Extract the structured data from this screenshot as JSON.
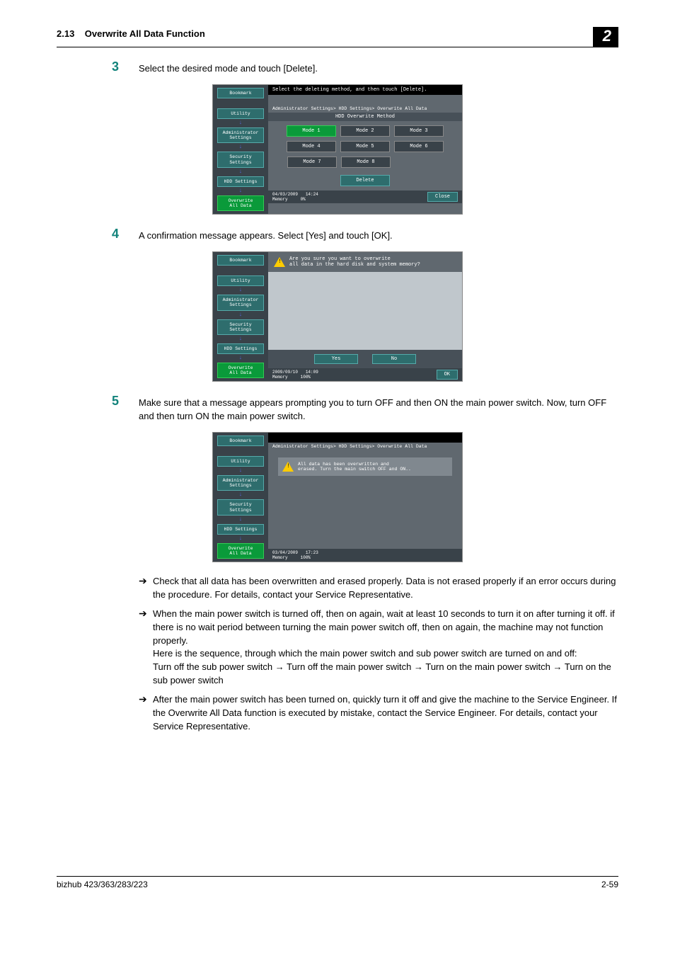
{
  "header": {
    "section": "2.13",
    "title": "Overwrite All Data Function",
    "chapter": "2"
  },
  "steps": {
    "s3": {
      "num": "3",
      "text": "Select the desired mode and touch [Delete]."
    },
    "s4": {
      "num": "4",
      "text": "A confirmation message appears. Select [Yes] and touch [OK]."
    },
    "s5": {
      "num": "5",
      "text": "Make sure that a message appears prompting you to turn OFF and then ON the main power switch. Now, turn OFF and then turn ON the main power switch."
    }
  },
  "shot1": {
    "title": "Select the deleting method, and then touch [Delete].",
    "crumb": "Administrator Settings> HDD Settings> Overwrite All Data",
    "panel": "HDD Overwrite Method",
    "modes": [
      "Mode 1",
      "Mode 2",
      "Mode 3",
      "Mode 4",
      "Mode 5",
      "Mode 6",
      "Mode 7",
      "Mode 8"
    ],
    "delete": "Delete",
    "date": "04/03/2009",
    "time": "14:24",
    "mem": "Memory",
    "mempct": "0%",
    "close": "Close",
    "nav": {
      "bookmark": "Bookmark",
      "utility": "Utility",
      "admin": "Administrator\nSettings",
      "security": "Security\nSettings",
      "hdd": "HDD Settings",
      "overwrite": "Overwrite\nAll Data"
    }
  },
  "shot2": {
    "msg": "Are you sure you want to overwrite\nall data in the hard disk and system memory?",
    "yes": "Yes",
    "no": "No",
    "date": "2009/09/10",
    "time": "14:09",
    "mem": "Memory",
    "mempct": "100%",
    "ok": "OK"
  },
  "shot3": {
    "crumb": "Administrator Settings> HDD Settings> Overwrite All Data",
    "innermsg": "All data has been overwritten and\nerased. Turn the main switch OFF and ON..",
    "date": "03/04/2009",
    "time": "17:23",
    "mem": "Memory",
    "mempct": "100%"
  },
  "bullets": {
    "b1": "Check that all data has been overwritten and erased properly. Data is not erased properly if an error occurs during the procedure. For details, contact your Service Representative.",
    "b2a": "When the main power switch is turned off, then on again, wait at least 10 seconds to turn it on after turning it off. if there is no wait period between turning the main power switch off, then on again, the machine may not function properly.",
    "b2b": "Here is the sequence, through which the main power switch and sub power switch are turned on and off:",
    "b2c": "Turn off the sub power switch → Turn off the main power switch → Turn on the main power switch → Turn on the sub power switch",
    "b3": "After the main power switch has been turned on, quickly turn it off and give the machine to the Service Engineer. If the Overwrite All Data function is executed by mistake, contact the Service Engineer. For details, contact your Service Representative."
  },
  "footer": {
    "model": "bizhub 423/363/283/223",
    "page": "2-59"
  }
}
